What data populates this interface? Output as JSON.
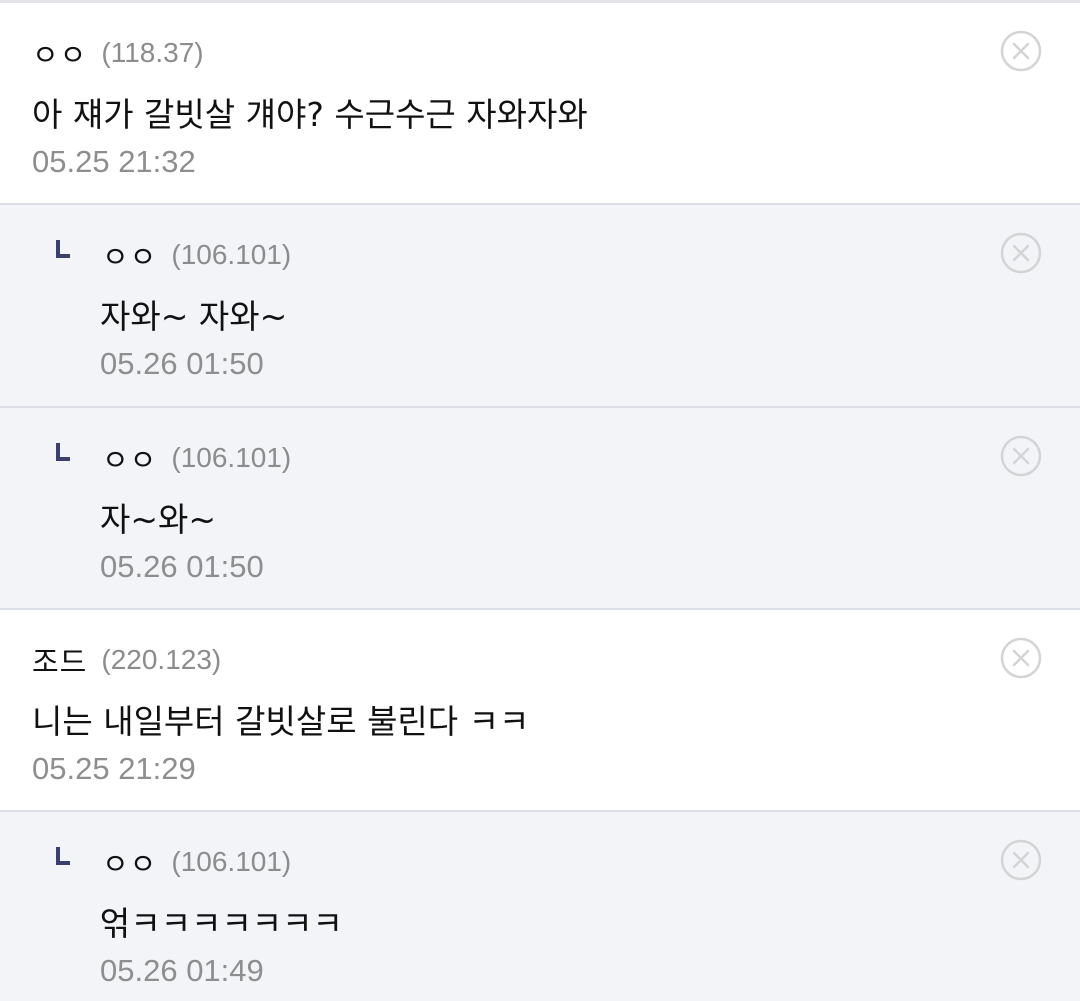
{
  "comments": [
    {
      "kind": "top",
      "nickname": "ㅇㅇ",
      "ip": "(118.37)",
      "text": "아 쟤가 갈빗살 걔야? 수근수근 자와자와",
      "timestamp": "05.25 21:32"
    },
    {
      "kind": "reply",
      "nickname": "ㅇㅇ",
      "ip": "(106.101)",
      "text": "자와~ 자와~",
      "timestamp": "05.26 01:50"
    },
    {
      "kind": "reply",
      "nickname": "ㅇㅇ",
      "ip": "(106.101)",
      "text": "자~와~",
      "timestamp": "05.26 01:50"
    },
    {
      "kind": "top",
      "nickname": "조드",
      "ip": "(220.123)",
      "text": "니는 내일부터 갈빗살로 불린다 ㅋㅋ",
      "timestamp": "05.25 21:29"
    },
    {
      "kind": "reply",
      "nickname": "ㅇㅇ",
      "ip": "(106.101)",
      "text": "얶ㅋㅋㅋㅋㅋㅋㅋ",
      "timestamp": "05.26 01:49"
    }
  ],
  "icons": {
    "reply": "reply-arrow-icon",
    "delete": "close-circle-icon"
  },
  "colors": {
    "reply_background": "#f3f4f8",
    "top_background": "#ffffff",
    "divider": "#dcdee5",
    "reply_arrow": "#3b3f6e",
    "muted_text": "#8e8e8e",
    "delete_icon": "#d4d4d4"
  }
}
